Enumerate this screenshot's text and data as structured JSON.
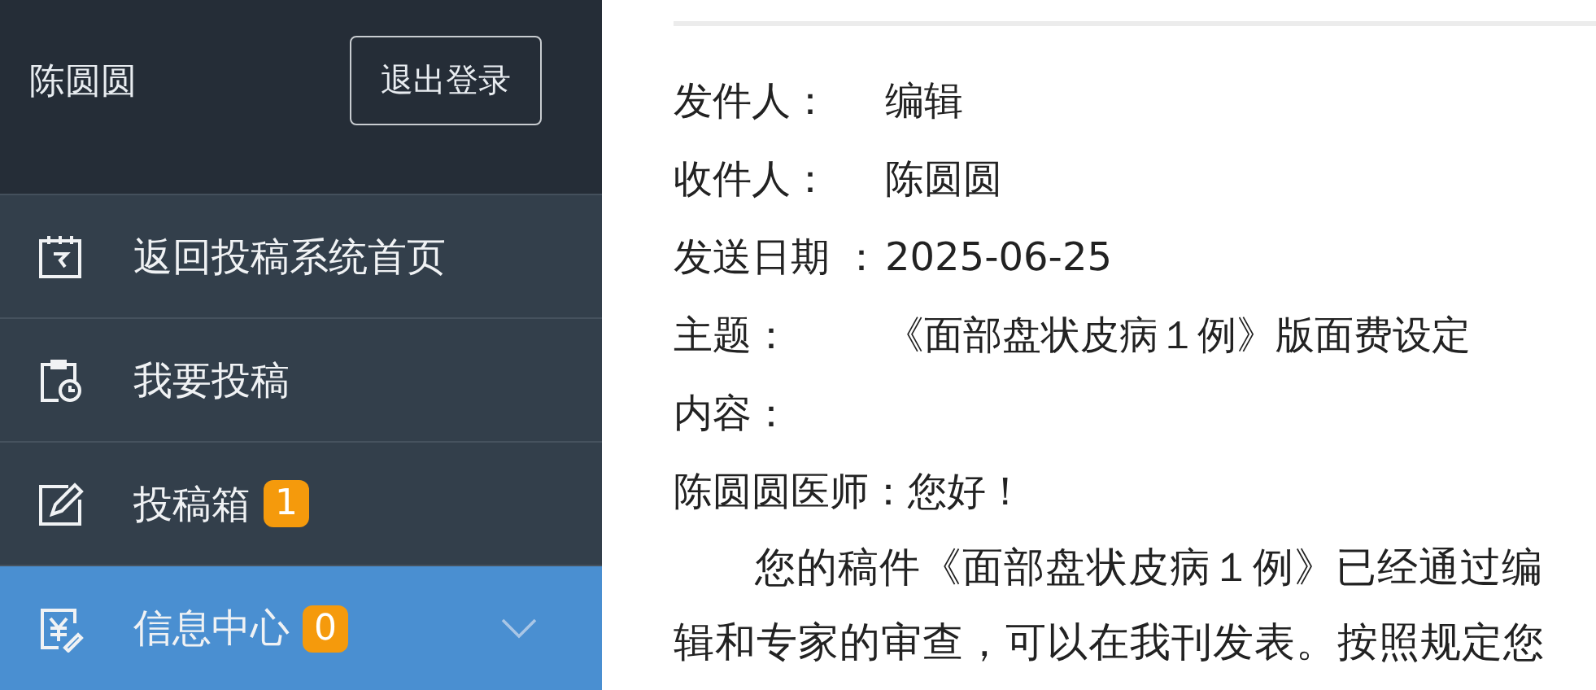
{
  "user": {
    "name": "陈圆圆",
    "logout": "退出登录"
  },
  "menu": [
    {
      "kind": "home",
      "label": "返回投稿系统首页",
      "selected": false
    },
    {
      "kind": "submit",
      "label": "我要投稿",
      "selected": false
    },
    {
      "kind": "outbox",
      "label": "投稿箱",
      "badge": "1",
      "selected": false
    },
    {
      "kind": "messages",
      "label": "信息中心",
      "badge": "0",
      "selected": true,
      "expanded": false
    }
  ],
  "message": {
    "fields": [
      {
        "label": "发件人：",
        "value": "编辑"
      },
      {
        "label": "收件人：",
        "value": "陈圆圆"
      },
      {
        "label": "发送日期 ：",
        "value": "2025-06-25"
      },
      {
        "label": "主题：",
        "value": "《面部盘状皮病１例》版面费设定"
      }
    ],
    "content_label": "内容：",
    "greeting": "陈圆圆医师：您好！",
    "body": "您的稿件《面部盘状皮病１例》已经通过编辑和专家的审查，可以在我刊发表。按照规定您"
  }
}
